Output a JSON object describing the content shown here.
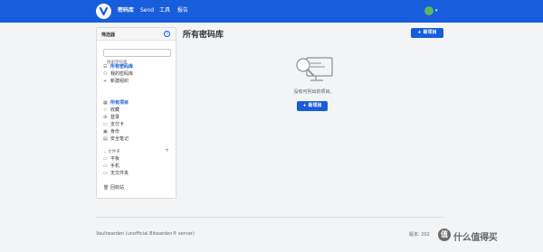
{
  "nav": {
    "items": [
      "密码库",
      "Send",
      "工具",
      "报告"
    ],
    "avatar_text": "●"
  },
  "sidebar": {
    "title": "筛选器",
    "help_icon": "?",
    "search_placeholder": "搜索密码库",
    "vaults": [
      {
        "label": "所有密码库",
        "icon": "☰"
      },
      {
        "label": "我的密码库",
        "icon": "⚇"
      },
      {
        "label": "新建组织",
        "icon": "+"
      }
    ],
    "items": [
      {
        "label": "所有项目",
        "icon": "▦"
      },
      {
        "label": "收藏",
        "icon": "☆"
      },
      {
        "label": "登录",
        "icon": "⊕"
      },
      {
        "label": "支付卡",
        "icon": "▭"
      },
      {
        "label": "身份",
        "icon": "▣"
      },
      {
        "label": "安全笔记",
        "icon": "▤"
      }
    ],
    "folders_header": "文件夹",
    "folders": [
      {
        "label": "平板",
        "icon": "▭"
      },
      {
        "label": "手机",
        "icon": "▭"
      },
      {
        "label": "无文件夹",
        "icon": "▭"
      }
    ],
    "trash": {
      "label": "回收站",
      "icon": "🗑"
    }
  },
  "main": {
    "title": "所有密码库",
    "new_item_label": "新项目",
    "empty_text": "没有可列出的项目。",
    "empty_button_label": "新项目"
  },
  "footer": {
    "left": "Vaultwarden (unofficial Bitwarden® server)",
    "right": "版本: 202"
  },
  "watermark": {
    "logo_char": "值",
    "text": "什么值得买"
  },
  "colors": {
    "brand": "#175ddc",
    "background": "#f3f4f6"
  }
}
